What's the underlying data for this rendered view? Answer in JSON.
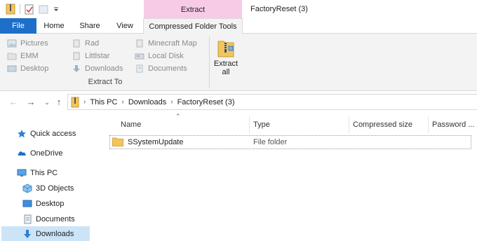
{
  "titlebar": {
    "context_label": "Extract",
    "window_title": "FactoryReset (3)"
  },
  "ribbon_tabs": {
    "file": "File",
    "home": "Home",
    "share": "Share",
    "view": "View",
    "tools": "Compressed Folder Tools"
  },
  "ribbon": {
    "col1": [
      "Pictures",
      "EMM",
      "Desktop"
    ],
    "col2": [
      "Rad",
      "Littlstar",
      "Downloads"
    ],
    "col3": [
      "Minecraft Map",
      "Local Disk",
      "Documents"
    ],
    "group_label": "Extract To",
    "extract_all_line1": "Extract",
    "extract_all_line2": "all"
  },
  "address": {
    "crumbs": [
      "This PC",
      "Downloads",
      "FactoryReset (3)"
    ]
  },
  "sidebar": {
    "quick_access": "Quick access",
    "onedrive": "OneDrive",
    "this_pc": "This PC",
    "objects_3d": "3D Objects",
    "desktop": "Desktop",
    "documents": "Documents",
    "downloads": "Downloads"
  },
  "columns": {
    "name": "Name",
    "type": "Type",
    "compressed_size": "Compressed size",
    "password": "Password ..."
  },
  "rows": [
    {
      "name": "SSystemUpdate",
      "type": "File folder"
    }
  ],
  "colors": {
    "file_tab": "#1d6fc9",
    "context_tab": "#f7cbe6",
    "selected_nav": "#cce4f7",
    "folder": "#f2c55c"
  }
}
